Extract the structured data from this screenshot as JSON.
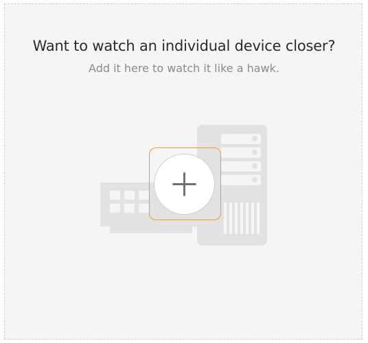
{
  "prompt": {
    "title": "Want to watch an individual device closer?",
    "subtitle": "Add it here to watch it like a hawk."
  },
  "colors": {
    "panel_background": "#f5f5f5",
    "panel_border": "#cfcfcf",
    "accent": "#f29a1d",
    "illustration": "#e2e2e2"
  },
  "icons": {
    "add": "plus-icon",
    "switch": "network-switch-icon",
    "server": "server-rack-icon"
  }
}
